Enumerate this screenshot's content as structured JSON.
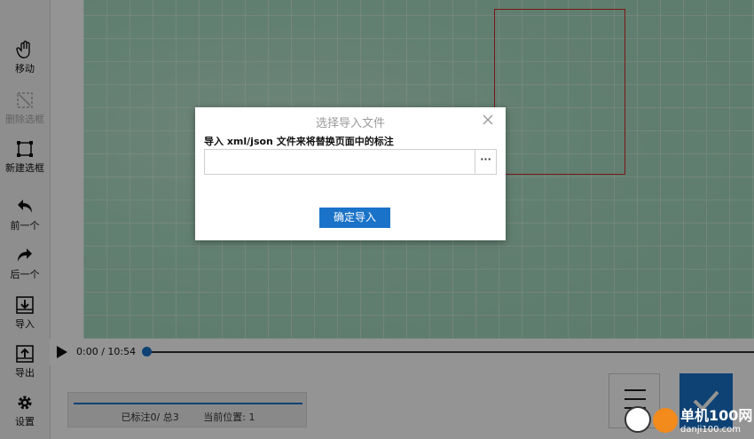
{
  "toolbar": {
    "items": [
      {
        "label": "移动",
        "icon": "hand-icon",
        "enabled": true
      },
      {
        "label": "删除选框",
        "icon": "delete-box-icon",
        "enabled": false
      },
      {
        "label": "新建选框",
        "icon": "new-box-icon",
        "enabled": true
      },
      {
        "label": "前一个",
        "icon": "undo-arrow-icon",
        "enabled": true
      },
      {
        "label": "后一个",
        "icon": "redo-arrow-icon",
        "enabled": true
      },
      {
        "label": "导入",
        "icon": "import-icon",
        "enabled": true
      },
      {
        "label": "导出",
        "icon": "export-icon",
        "enabled": true
      },
      {
        "label": "设置",
        "icon": "gear-icon",
        "enabled": true
      }
    ]
  },
  "player": {
    "time": "0:00 / 10:54",
    "progress": 0
  },
  "status": {
    "labeled": "已标注0/ 总3",
    "position": "当前位置: 1"
  },
  "dialog": {
    "title": "选择导入文件",
    "label": "导入 xml/json 文件来将替换页面中的标注",
    "file_value": "",
    "browse_label": "···",
    "confirm_label": "确定导入"
  },
  "watermark": {
    "line1": "单机100网",
    "line2": "danji100.com"
  },
  "colors": {
    "accent": "#1a73c8",
    "box": "#d02626",
    "overlay": "rgba(0,0,0,0.42)"
  }
}
